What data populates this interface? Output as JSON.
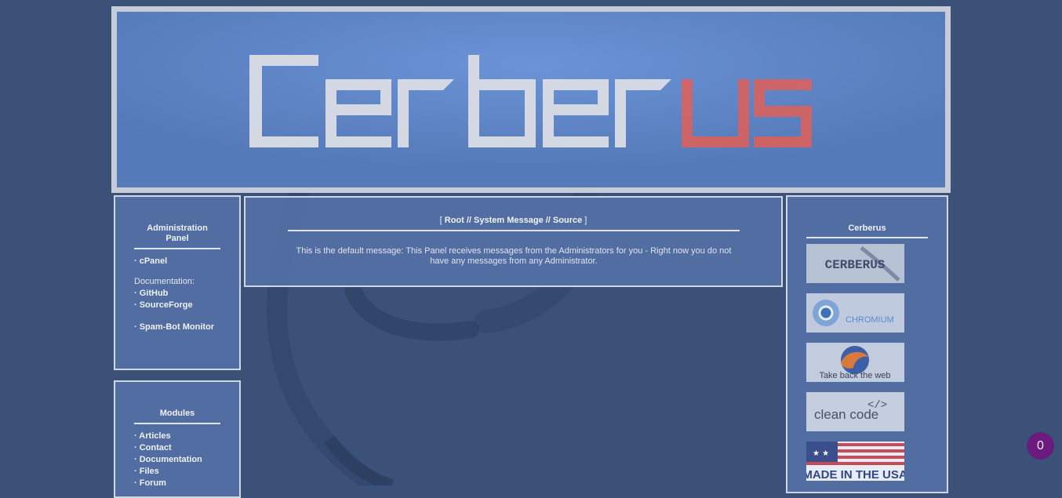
{
  "banner": {
    "logo_text": "Cerberus"
  },
  "admin_panel": {
    "title": "Administration Panel",
    "cpanel_label": "· cPanel",
    "documentation_label": "Documentation:",
    "github_label": "· GitHub",
    "sourceforge_label": "· SourceForge",
    "spambot_label": "· Spam-Bot Monitor"
  },
  "modules_panel": {
    "title": "Modules",
    "items": [
      "· Articles",
      "· Contact",
      "· Documentation",
      "· Files",
      "· Forum"
    ]
  },
  "main": {
    "heading_open": "[",
    "heading_text": "Root // System Message // Source",
    "heading_close": "]",
    "message": "This is the default message: This Panel receives messages from the Administrators for you - Right now you do not have any messages from any Administrator."
  },
  "right_panel": {
    "title": "Cerberus",
    "badges": [
      {
        "name": "cerberus-badge",
        "text": "CERBERUS"
      },
      {
        "name": "chromium-badge",
        "text": "CHROMIUM"
      },
      {
        "name": "firefox-badge",
        "text": "Take back the web"
      },
      {
        "name": "clean-code-badge",
        "text": "clean code"
      },
      {
        "name": "made-in-usa-badge",
        "text": "MADE IN THE USA"
      }
    ]
  },
  "notification": {
    "count": "0"
  },
  "colors": {
    "background": "#3b5178",
    "panel": "#5470a5",
    "banner": "#5f86c8",
    "accent_red": "#d9625e",
    "notification": "#6a1b7d"
  }
}
